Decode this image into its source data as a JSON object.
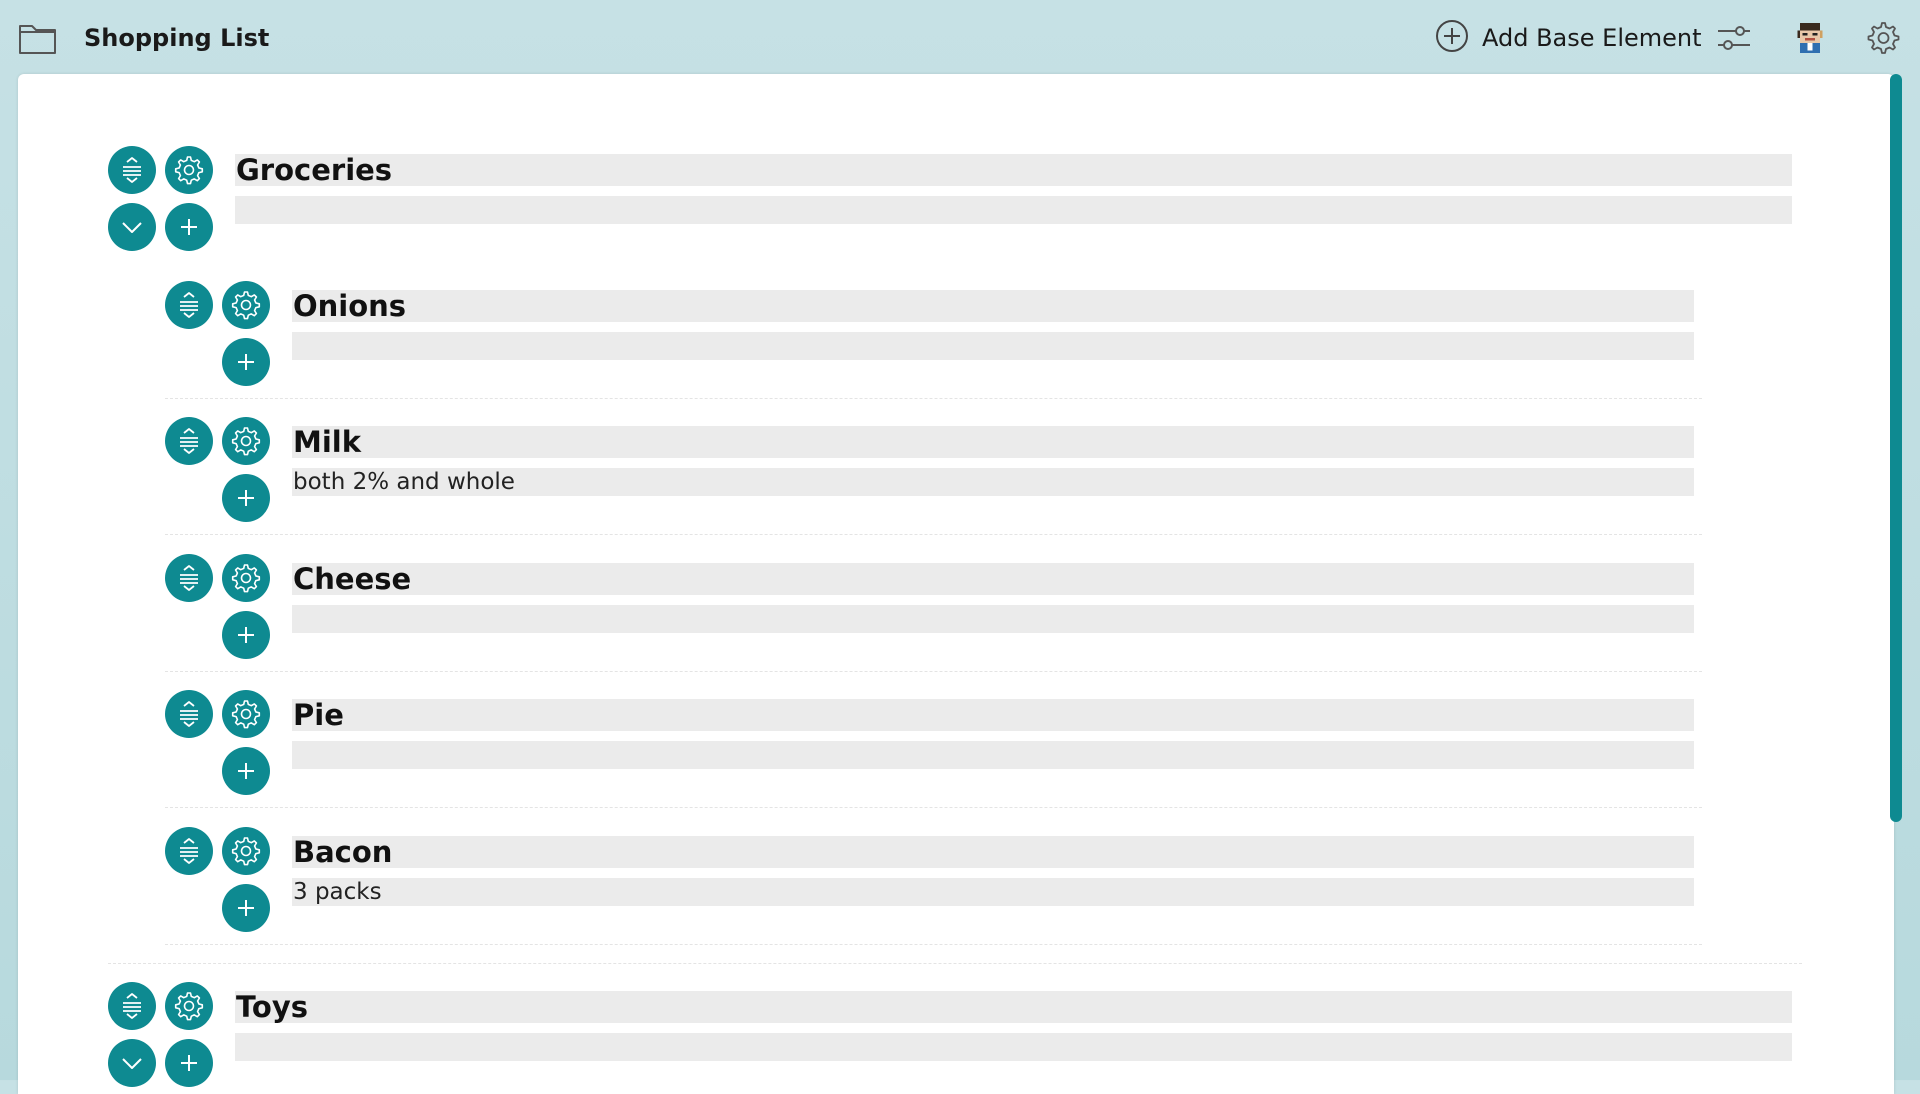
{
  "window": {
    "title": "Shopping List",
    "folder_icon": "folder-icon",
    "add_base_element_label": "Add Base Element",
    "add_icon": "plus-circle-icon",
    "filter_icon": "sliders-icon",
    "avatar_icon": "pixel-avatar-icon",
    "settings_icon": "gear-icon"
  },
  "colors": {
    "accent": "#0e8a91",
    "field_bg": "#ebebeb",
    "window_bg": "#c6e1e5"
  },
  "items": [
    {
      "title": "Groceries",
      "description": "",
      "expandable": true,
      "children": [
        {
          "title": "Onions",
          "description": ""
        },
        {
          "title": "Milk",
          "description": "both 2% and whole"
        },
        {
          "title": "Cheese",
          "description": ""
        },
        {
          "title": "Pie",
          "description": ""
        },
        {
          "title": "Bacon",
          "description": "3 packs"
        }
      ]
    },
    {
      "title": "Toys",
      "description": "",
      "expandable": true,
      "children": []
    }
  ]
}
